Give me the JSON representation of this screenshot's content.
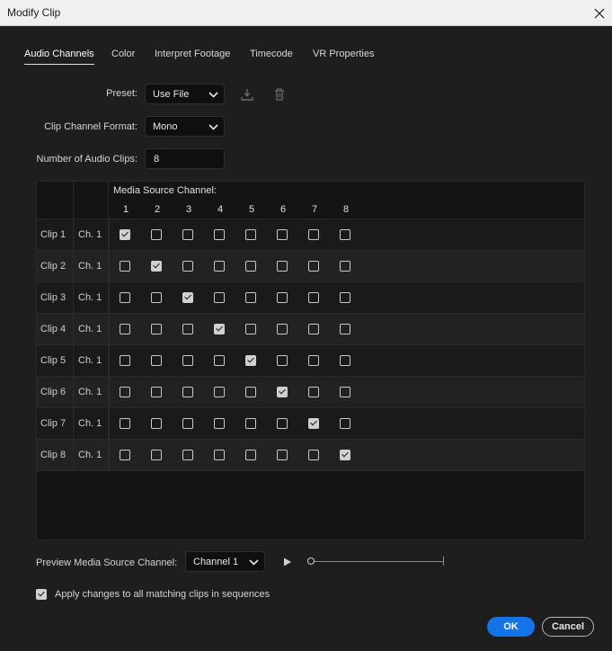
{
  "window": {
    "title": "Modify Clip"
  },
  "tabs": [
    {
      "label": "Audio Channels",
      "active": true
    },
    {
      "label": "Color",
      "active": false
    },
    {
      "label": "Interpret Footage",
      "active": false
    },
    {
      "label": "Timecode",
      "active": false
    },
    {
      "label": "VR Properties",
      "active": false
    }
  ],
  "preset": {
    "label": "Preset:",
    "value": "Use File"
  },
  "clip_channel_format": {
    "label": "Clip Channel Format:",
    "value": "Mono"
  },
  "number_of_audio_clips": {
    "label": "Number of Audio Clips:",
    "value": "8"
  },
  "grid": {
    "header": "Media Source Channel:",
    "channel_numbers": [
      "1",
      "2",
      "3",
      "4",
      "5",
      "6",
      "7",
      "8"
    ],
    "rows": [
      {
        "clip": "Clip 1",
        "ch": "Ch. 1",
        "checked": [
          true,
          false,
          false,
          false,
          false,
          false,
          false,
          false
        ]
      },
      {
        "clip": "Clip 2",
        "ch": "Ch. 1",
        "checked": [
          false,
          true,
          false,
          false,
          false,
          false,
          false,
          false
        ]
      },
      {
        "clip": "Clip 3",
        "ch": "Ch. 1",
        "checked": [
          false,
          false,
          true,
          false,
          false,
          false,
          false,
          false
        ]
      },
      {
        "clip": "Clip 4",
        "ch": "Ch. 1",
        "checked": [
          false,
          false,
          false,
          true,
          false,
          false,
          false,
          false
        ]
      },
      {
        "clip": "Clip 5",
        "ch": "Ch. 1",
        "checked": [
          false,
          false,
          false,
          false,
          true,
          false,
          false,
          false
        ]
      },
      {
        "clip": "Clip 6",
        "ch": "Ch. 1",
        "checked": [
          false,
          false,
          false,
          false,
          false,
          true,
          false,
          false
        ]
      },
      {
        "clip": "Clip 7",
        "ch": "Ch. 1",
        "checked": [
          false,
          false,
          false,
          false,
          false,
          false,
          true,
          false
        ]
      },
      {
        "clip": "Clip 8",
        "ch": "Ch. 1",
        "checked": [
          false,
          false,
          false,
          false,
          false,
          false,
          false,
          true
        ]
      }
    ]
  },
  "preview": {
    "label": "Preview Media Source Channel:",
    "value": "Channel 1",
    "progress": 0
  },
  "apply_all": {
    "label": "Apply changes to all matching clips in sequences",
    "checked": true
  },
  "buttons": {
    "ok": "OK",
    "cancel": "Cancel"
  },
  "colors": {
    "accent": "#1473e6",
    "background": "#1e1e1e",
    "titlebar": "#f0f0f0"
  },
  "icons": [
    "close-icon",
    "chevron-down-icon",
    "download-icon",
    "trash-icon",
    "play-icon",
    "checkmark-icon"
  ]
}
